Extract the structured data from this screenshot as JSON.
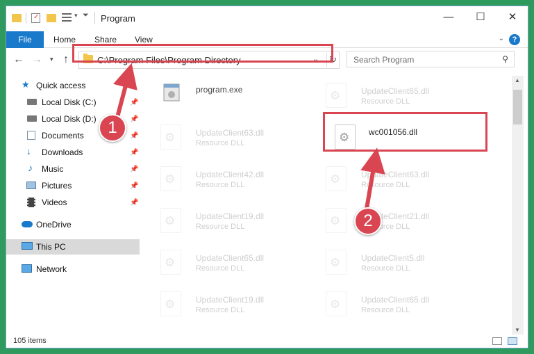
{
  "window": {
    "title": "Program",
    "controls": {
      "minimize": "—",
      "maximize": "☐",
      "close": "✕"
    }
  },
  "ribbon": {
    "tabs": [
      "File",
      "Home",
      "Share",
      "View"
    ],
    "help_label": "?"
  },
  "nav": {
    "address_path": "C:\\Program Files\\Program Directory",
    "search_placeholder": "Search Program"
  },
  "sidebar": {
    "items": [
      {
        "label": "Quick access",
        "icon": "star-icon",
        "pinned": false
      },
      {
        "label": "Local Disk (C:)",
        "icon": "drive-icon",
        "pinned": true
      },
      {
        "label": "Local Disk (D:)",
        "icon": "drive-icon",
        "pinned": true
      },
      {
        "label": "Documents",
        "icon": "documents-icon",
        "pinned": true
      },
      {
        "label": "Downloads",
        "icon": "download-arrow-icon",
        "pinned": true
      },
      {
        "label": "Music",
        "icon": "music-note-icon",
        "pinned": true
      },
      {
        "label": "Pictures",
        "icon": "pictures-icon",
        "pinned": true
      },
      {
        "label": "Videos",
        "icon": "film-icon",
        "pinned": true
      },
      {
        "label": "OneDrive",
        "icon": "cloud-icon",
        "pinned": false
      },
      {
        "label": "This PC",
        "icon": "monitor-icon",
        "pinned": false,
        "selected": true
      },
      {
        "label": "Network",
        "icon": "network-icon",
        "pinned": false
      }
    ]
  },
  "files": [
    {
      "name": "program.exe",
      "type": "",
      "icon": "exe-icon",
      "faded": false
    },
    {
      "name": "UpdateClient65.dll",
      "type": "Resource DLL",
      "icon": "dll-gear-icon",
      "faded": true
    },
    {
      "name": "UpdateClient63.dll",
      "type": "Resource DLL",
      "icon": "dll-gear-icon",
      "faded": true
    },
    {
      "name": "wc001056.dll",
      "type": "",
      "icon": "dll-gear-icon",
      "faded": false
    },
    {
      "name": "UpdateClient42.dll",
      "type": "Resource DLL",
      "icon": "dll-gear-icon",
      "faded": true
    },
    {
      "name": "UpdateClient63.dll",
      "type": "Resource DLL",
      "icon": "dll-gear-icon",
      "faded": true
    },
    {
      "name": "UpdateClient19.dll",
      "type": "Resource DLL",
      "icon": "dll-gear-icon",
      "faded": true
    },
    {
      "name": "UpdateClient21.dll",
      "type": "Resource DLL",
      "icon": "dll-gear-icon",
      "faded": true
    },
    {
      "name": "UpdateClient65.dll",
      "type": "Resource DLL",
      "icon": "dll-gear-icon",
      "faded": true
    },
    {
      "name": "UpdateClient5.dll",
      "type": "Resource DLL",
      "icon": "dll-gear-icon",
      "faded": true
    },
    {
      "name": "UpdateClient19.dll",
      "type": "Resource DLL",
      "icon": "dll-gear-icon",
      "faded": true
    },
    {
      "name": "UpdateClient65.dll",
      "type": "Resource DLL",
      "icon": "dll-gear-icon",
      "faded": true
    }
  ],
  "status": {
    "item_count": "105 items"
  },
  "callouts": {
    "step1": "1",
    "step2": "2"
  },
  "colors": {
    "accent": "#1979ca",
    "highlight": "#d94652",
    "folder": "#f1c64a",
    "background": "#2e9a5e"
  }
}
